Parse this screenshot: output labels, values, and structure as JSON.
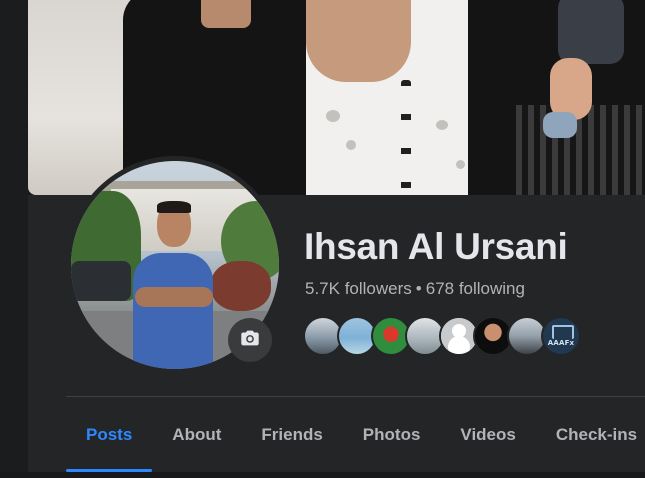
{
  "profile": {
    "name": "Ihsan Al Ursani",
    "followers": "5.7K followers",
    "separator": "•",
    "following": "678 following"
  },
  "camera_icon": "camera-icon",
  "mutual_friends": [
    {
      "icon": "friend-avatar-1"
    },
    {
      "icon": "friend-avatar-2"
    },
    {
      "icon": "friend-avatar-3"
    },
    {
      "icon": "friend-avatar-4"
    },
    {
      "icon": "friend-avatar-5"
    },
    {
      "icon": "friend-avatar-6"
    },
    {
      "icon": "friend-avatar-7"
    },
    {
      "icon": "friend-avatar-8",
      "label": "AAAFx"
    }
  ],
  "tabs": [
    {
      "label": "Posts",
      "active": true
    },
    {
      "label": "About"
    },
    {
      "label": "Friends"
    },
    {
      "label": "Photos"
    },
    {
      "label": "Videos"
    },
    {
      "label": "Check-ins"
    }
  ],
  "colors": {
    "background": "#242526",
    "page": "#18191a",
    "name_text": "#e4e6eb",
    "secondary_text": "#b0b3b8",
    "accent": "#2d88ff",
    "divider": "#3e4042"
  }
}
